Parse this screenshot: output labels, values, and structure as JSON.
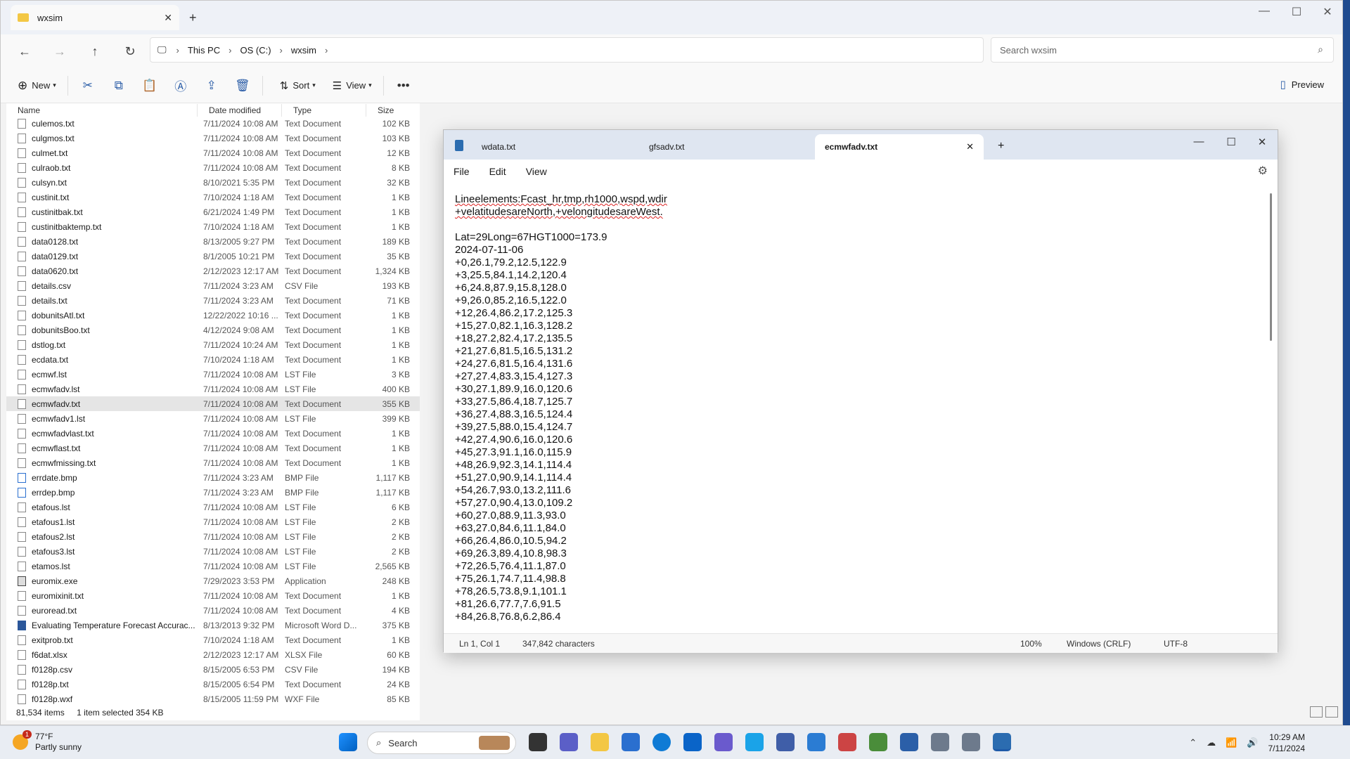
{
  "explorer": {
    "tab_title": "wxsim",
    "address": {
      "root": "This PC",
      "crumbs": [
        "This PC",
        "OS (C:)",
        "wxsim"
      ]
    },
    "search_placeholder": "Search wxsim",
    "toolbar": {
      "new_label": "New",
      "sort_label": "Sort",
      "view_label": "View",
      "preview_label": "Preview"
    },
    "columns": [
      "Name",
      "Date modified",
      "Type",
      "Size"
    ],
    "rows": [
      {
        "name": "culemos.txt",
        "date": "7/11/2024 10:08 AM",
        "type": "Text Document",
        "size": "102 KB"
      },
      {
        "name": "culgmos.txt",
        "date": "7/11/2024 10:08 AM",
        "type": "Text Document",
        "size": "103 KB"
      },
      {
        "name": "culmet.txt",
        "date": "7/11/2024 10:08 AM",
        "type": "Text Document",
        "size": "12 KB"
      },
      {
        "name": "culraob.txt",
        "date": "7/11/2024 10:08 AM",
        "type": "Text Document",
        "size": "8 KB"
      },
      {
        "name": "culsyn.txt",
        "date": "8/10/2021 5:35 PM",
        "type": "Text Document",
        "size": "32 KB"
      },
      {
        "name": "custinit.txt",
        "date": "7/10/2024 1:18 AM",
        "type": "Text Document",
        "size": "1 KB"
      },
      {
        "name": "custinitbak.txt",
        "date": "6/21/2024 1:49 PM",
        "type": "Text Document",
        "size": "1 KB"
      },
      {
        "name": "custinitbaktemp.txt",
        "date": "7/10/2024 1:18 AM",
        "type": "Text Document",
        "size": "1 KB"
      },
      {
        "name": "data0128.txt",
        "date": "8/13/2005 9:27 PM",
        "type": "Text Document",
        "size": "189 KB"
      },
      {
        "name": "data0129.txt",
        "date": "8/1/2005 10:21 PM",
        "type": "Text Document",
        "size": "35 KB"
      },
      {
        "name": "data0620.txt",
        "date": "2/12/2023 12:17 AM",
        "type": "Text Document",
        "size": "1,324 KB"
      },
      {
        "name": "details.csv",
        "date": "7/11/2024 3:23 AM",
        "type": "CSV File",
        "size": "193 KB"
      },
      {
        "name": "details.txt",
        "date": "7/11/2024 3:23 AM",
        "type": "Text Document",
        "size": "71 KB"
      },
      {
        "name": "dobunitsAtl.txt",
        "date": "12/22/2022 10:16 ...",
        "type": "Text Document",
        "size": "1 KB"
      },
      {
        "name": "dobunitsBoo.txt",
        "date": "4/12/2024 9:08 AM",
        "type": "Text Document",
        "size": "1 KB"
      },
      {
        "name": "dstlog.txt",
        "date": "7/11/2024 10:24 AM",
        "type": "Text Document",
        "size": "1 KB"
      },
      {
        "name": "ecdata.txt",
        "date": "7/10/2024 1:18 AM",
        "type": "Text Document",
        "size": "1 KB"
      },
      {
        "name": "ecmwf.lst",
        "date": "7/11/2024 10:08 AM",
        "type": "LST File",
        "size": "3 KB"
      },
      {
        "name": "ecmwfadv.lst",
        "date": "7/11/2024 10:08 AM",
        "type": "LST File",
        "size": "400 KB"
      },
      {
        "name": "ecmwfadv.txt",
        "date": "7/11/2024 10:08 AM",
        "type": "Text Document",
        "size": "355 KB",
        "selected": true
      },
      {
        "name": "ecmwfadv1.lst",
        "date": "7/11/2024 10:08 AM",
        "type": "LST File",
        "size": "399 KB"
      },
      {
        "name": "ecmwfadvlast.txt",
        "date": "7/11/2024 10:08 AM",
        "type": "Text Document",
        "size": "1 KB"
      },
      {
        "name": "ecmwflast.txt",
        "date": "7/11/2024 10:08 AM",
        "type": "Text Document",
        "size": "1 KB"
      },
      {
        "name": "ecmwfmissing.txt",
        "date": "7/11/2024 10:08 AM",
        "type": "Text Document",
        "size": "1 KB"
      },
      {
        "name": "errdate.bmp",
        "date": "7/11/2024 3:23 AM",
        "type": "BMP File",
        "size": "1,117 KB",
        "icon": "bmp"
      },
      {
        "name": "errdep.bmp",
        "date": "7/11/2024 3:23 AM",
        "type": "BMP File",
        "size": "1,117 KB",
        "icon": "bmp"
      },
      {
        "name": "etafous.lst",
        "date": "7/11/2024 10:08 AM",
        "type": "LST File",
        "size": "6 KB"
      },
      {
        "name": "etafous1.lst",
        "date": "7/11/2024 10:08 AM",
        "type": "LST File",
        "size": "2 KB"
      },
      {
        "name": "etafous2.lst",
        "date": "7/11/2024 10:08 AM",
        "type": "LST File",
        "size": "2 KB"
      },
      {
        "name": "etafous3.lst",
        "date": "7/11/2024 10:08 AM",
        "type": "LST File",
        "size": "2 KB"
      },
      {
        "name": "etamos.lst",
        "date": "7/11/2024 10:08 AM",
        "type": "LST File",
        "size": "2,565 KB"
      },
      {
        "name": "euromix.exe",
        "date": "7/29/2023 3:53 PM",
        "type": "Application",
        "size": "248 KB",
        "icon": "exe"
      },
      {
        "name": "euromixinit.txt",
        "date": "7/11/2024 10:08 AM",
        "type": "Text Document",
        "size": "1 KB"
      },
      {
        "name": "euroread.txt",
        "date": "7/11/2024 10:08 AM",
        "type": "Text Document",
        "size": "4 KB"
      },
      {
        "name": "Evaluating Temperature Forecast Accurac...",
        "date": "8/13/2013 9:32 PM",
        "type": "Microsoft Word D...",
        "size": "375 KB",
        "icon": "doc"
      },
      {
        "name": "exitprob.txt",
        "date": "7/10/2024 1:18 AM",
        "type": "Text Document",
        "size": "1 KB"
      },
      {
        "name": "f6dat.xlsx",
        "date": "2/12/2023 12:17 AM",
        "type": "XLSX File",
        "size": "60 KB"
      },
      {
        "name": "f0128p.csv",
        "date": "8/15/2005 6:53 PM",
        "type": "CSV File",
        "size": "194 KB"
      },
      {
        "name": "f0128p.txt",
        "date": "8/15/2005 6:54 PM",
        "type": "Text Document",
        "size": "24 KB"
      },
      {
        "name": "f0128p.wxf",
        "date": "8/15/2005 11:59 PM",
        "type": "WXF File",
        "size": "85 KB"
      }
    ],
    "status": {
      "items": "81,534 items",
      "selected": "1 item selected  354 KB"
    }
  },
  "notepad": {
    "tabs": [
      "wdata.txt",
      "gfsadv.txt",
      "ecmwfadv.txt"
    ],
    "menu": [
      "File",
      "Edit",
      "View"
    ],
    "text_lines": [
      "Lineelements:Fcast_hr,tmp,rh1000,wspd,wdir",
      "+velatitudesareNorth,+velongitudesareWest.",
      "",
      "Lat=29Long=67HGT1000=173.9",
      "2024-07-11-06",
      "+0,26.1,79.2,12.5,122.9",
      "+3,25.5,84.1,14.2,120.4",
      "+6,24.8,87.9,15.8,128.0",
      "+9,26.0,85.2,16.5,122.0",
      "+12,26.4,86.2,17.2,125.3",
      "+15,27.0,82.1,16.3,128.2",
      "+18,27.2,82.4,17.2,135.5",
      "+21,27.6,81.5,16.5,131.2",
      "+24,27.6,81.5,16.4,131.6",
      "+27,27.4,83.3,15.4,127.3",
      "+30,27.1,89.9,16.0,120.6",
      "+33,27.5,86.4,18.7,125.7",
      "+36,27.4,88.3,16.5,124.4",
      "+39,27.5,88.0,15.4,124.7",
      "+42,27.4,90.6,16.0,120.6",
      "+45,27.3,91.1,16.0,115.9",
      "+48,26.9,92.3,14.1,114.4",
      "+51,27.0,90.9,14.1,114.4",
      "+54,26.7,93.0,13.2,111.6",
      "+57,27.0,90.4,13.0,109.2",
      "+60,27.0,88.9,11.3,93.0",
      "+63,27.0,84.6,11.1,84.0",
      "+66,26.4,86.0,10.5,94.2",
      "+69,26.3,89.4,10.8,98.3",
      "+72,26.5,76.4,11.1,87.0",
      "+75,26.1,74.7,11.4,98.8",
      "+78,26.5,73.8,9.1,101.1",
      "+81,26.6,77.7,7.6,91.5",
      "+84,26.8,76.8,6.2,86.4"
    ],
    "status": {
      "position": "Ln 1, Col 1",
      "chars": "347,842 characters",
      "zoom": "100%",
      "eol": "Windows (CRLF)",
      "encoding": "UTF-8"
    }
  },
  "taskbar": {
    "weather_temp": "77°F",
    "weather_desc": "Partly sunny",
    "weather_badge": "1",
    "search_label": "Search",
    "time": "10:29 AM",
    "date": "7/11/2024"
  }
}
